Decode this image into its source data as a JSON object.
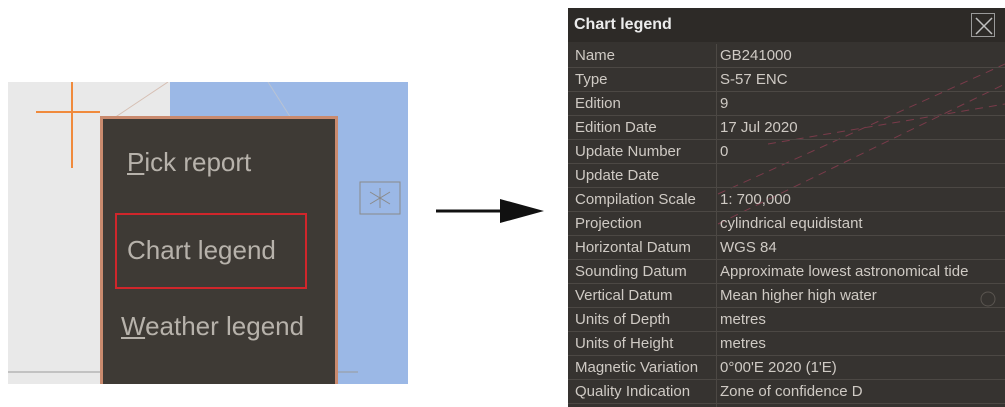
{
  "context_menu": {
    "items": [
      {
        "label": "Pick report",
        "accel": "P",
        "rest": "ick report"
      },
      {
        "label": "Chart legend",
        "accel": "",
        "rest": "Chart legend"
      },
      {
        "label": "Weather legend",
        "accel": "W",
        "rest": "eather legend"
      }
    ],
    "highlighted": "Chart legend"
  },
  "legend": {
    "title": "Chart legend",
    "rows": [
      {
        "key": "Name",
        "value": "GB241000"
      },
      {
        "key": "Type",
        "value": "S-57 ENC"
      },
      {
        "key": "Edition",
        "value": "9"
      },
      {
        "key": "Edition Date",
        "value": "17 Jul 2020"
      },
      {
        "key": "Update Number",
        "value": "0"
      },
      {
        "key": "Update Date",
        "value": ""
      },
      {
        "key": "Compilation Scale",
        "value": "1: 700,000"
      },
      {
        "key": "Projection",
        "value": "cylindrical equidistant"
      },
      {
        "key": "Horizontal Datum",
        "value": "WGS 84"
      },
      {
        "key": "Sounding Datum",
        "value": "Approximate lowest astronomical tide"
      },
      {
        "key": "Vertical Datum",
        "value": "Mean higher high water"
      },
      {
        "key": "Units of Depth",
        "value": "metres"
      },
      {
        "key": "Units of Height",
        "value": "metres"
      },
      {
        "key": "Magnetic Variation",
        "value": "0°00'E 2020 (1'E)"
      },
      {
        "key": "Quality Indication",
        "value": "Zone of confidence D"
      }
    ]
  },
  "colors": {
    "menu_bg": "#3e3a35",
    "highlight": "#d0262b",
    "panel_bg": "#363330",
    "sea": "#9bb8e6"
  }
}
